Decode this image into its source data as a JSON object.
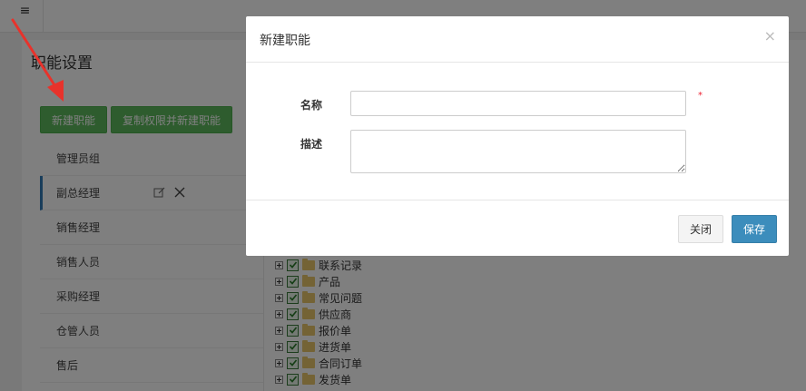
{
  "topbar": {
    "menu_icon": "hamburger-icon"
  },
  "page": {
    "title": "职能设置"
  },
  "toolbar": {
    "new_role_label": "新建职能",
    "copy_role_label": "复制权限并新建职能",
    "accent": "#5cb85c"
  },
  "roles": [
    {
      "label": "管理员组"
    },
    {
      "label": "副总经理"
    },
    {
      "label": "销售经理"
    },
    {
      "label": "销售人员"
    },
    {
      "label": "采购经理"
    },
    {
      "label": "仓管人员"
    },
    {
      "label": "售后"
    }
  ],
  "tree": [
    {
      "label": "联系记录"
    },
    {
      "label": "产品"
    },
    {
      "label": "常见问题"
    },
    {
      "label": "供应商"
    },
    {
      "label": "报价单"
    },
    {
      "label": "进货单"
    },
    {
      "label": "合同订单"
    },
    {
      "label": "发货单"
    }
  ],
  "modal": {
    "title": "新建职能",
    "close_glyph": "×",
    "name_label": "名称",
    "name_value": "",
    "required_mark": "*",
    "desc_label": "描述",
    "desc_value": "",
    "close_button": "关闭",
    "save_button": "保存",
    "save_color": "#3c8dbc"
  },
  "annotation": {
    "arrow_color": "#e8322b"
  }
}
